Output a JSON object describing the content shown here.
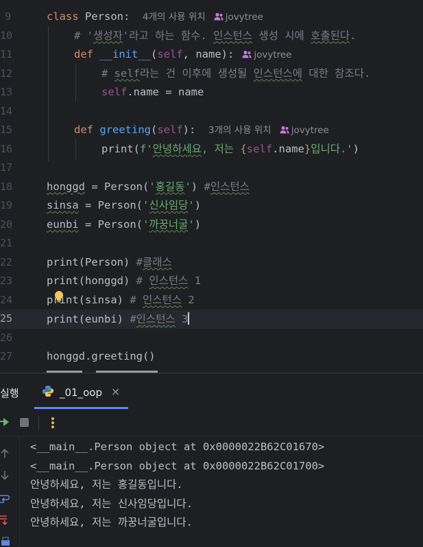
{
  "editor": {
    "line_numbers": [
      "9",
      "10",
      "11",
      "12",
      "13",
      "14",
      "15",
      "16",
      "17",
      "18",
      "19",
      "20",
      "21",
      "22",
      "23",
      "24",
      "25",
      "26",
      "27"
    ],
    "l9": {
      "kw": "class",
      "name": " Person:",
      "hint": "4개의 사용 위치",
      "author": "jovytree"
    },
    "l10": {
      "comment_a": "# '",
      "comment_b": "생성자",
      "comment_c": "'라고 하는 함수. ",
      "comment_d": "인스턴스",
      "comment_e": " 생성 시에 ",
      "comment_f": "호출된다",
      "comment_g": "."
    },
    "l11": {
      "kw": "def",
      "fn": "__init__",
      "p1": "(",
      "self": "self",
      "p2": ", name):",
      "author": "jovytree"
    },
    "l12": {
      "comment_a": "# ",
      "comment_self": "self",
      "comment_b": "라는 건 이후에 생성될 ",
      "comment_c": "인스턴스에",
      "comment_d": " 대한 참조다."
    },
    "l13": {
      "self": "self",
      "rest": ".name = name"
    },
    "l15": {
      "kw": "def",
      "fn": "greeting",
      "p1": "(",
      "self": "self",
      "p2": "):",
      "hint": "3개의 사용 위치",
      "author": "jovytree"
    },
    "l16": {
      "a": "print(",
      "b": "f'",
      "c": "안녕하세요",
      "d": ", 저는 ",
      "e": "{",
      "f": "self",
      "g": ".name",
      "h": "}",
      "i": "입니다.'",
      "j": ")"
    },
    "l18": {
      "var": "honggd",
      "a": " = Person(",
      "s1": "'",
      "s2": "홍길동",
      "s3": "'",
      "b": ") ",
      "c1": "#",
      "c2": "인스턴스"
    },
    "l19": {
      "var": "sinsa",
      "a": " = Person(",
      "s1": "'",
      "s2": "신사임당",
      "s3": "'",
      "b": ")"
    },
    "l20": {
      "var": "eunbi",
      "a": " = Person(",
      "s1": "'",
      "s2": "까꿍너굴",
      "s3": "'",
      "b": ")"
    },
    "l22": {
      "a": "print(Person) ",
      "c1": "#",
      "c2": "클래스"
    },
    "l23": {
      "a": "print(honggd) ",
      "c1": "# ",
      "c2": "인스턴스",
      "c3": " 1"
    },
    "l24": {
      "a": "print(sinsa) ",
      "c1": "# ",
      "c2": "인스턴스",
      "c3": " 2"
    },
    "l25": {
      "a": "print(eunbi) ",
      "c1": "#",
      "c2": "인스턴스",
      "c3": " 3"
    },
    "l27": {
      "a": "honggd.greeting()"
    }
  },
  "run_panel": {
    "label": "실행",
    "tab_title": "_01_oop",
    "tab_close": "×"
  },
  "console": {
    "lines": [
      "<__main__.Person object at 0x0000022B62C01670>",
      "<__main__.Person object at 0x0000022B62C01700>",
      "안녕하세요, 저는 홍길동입니다.",
      "안녕하세요, 저는 신사임당입니다.",
      "안녕하세요, 저는 까꿍너굴입니다."
    ]
  },
  "colors": {
    "background": "#1e1f22",
    "keyword": "#cf8e6d",
    "function": "#56a8f5",
    "self": "#94558d",
    "string": "#6aab73",
    "comment": "#7a7e85",
    "accent": "#548af7"
  }
}
